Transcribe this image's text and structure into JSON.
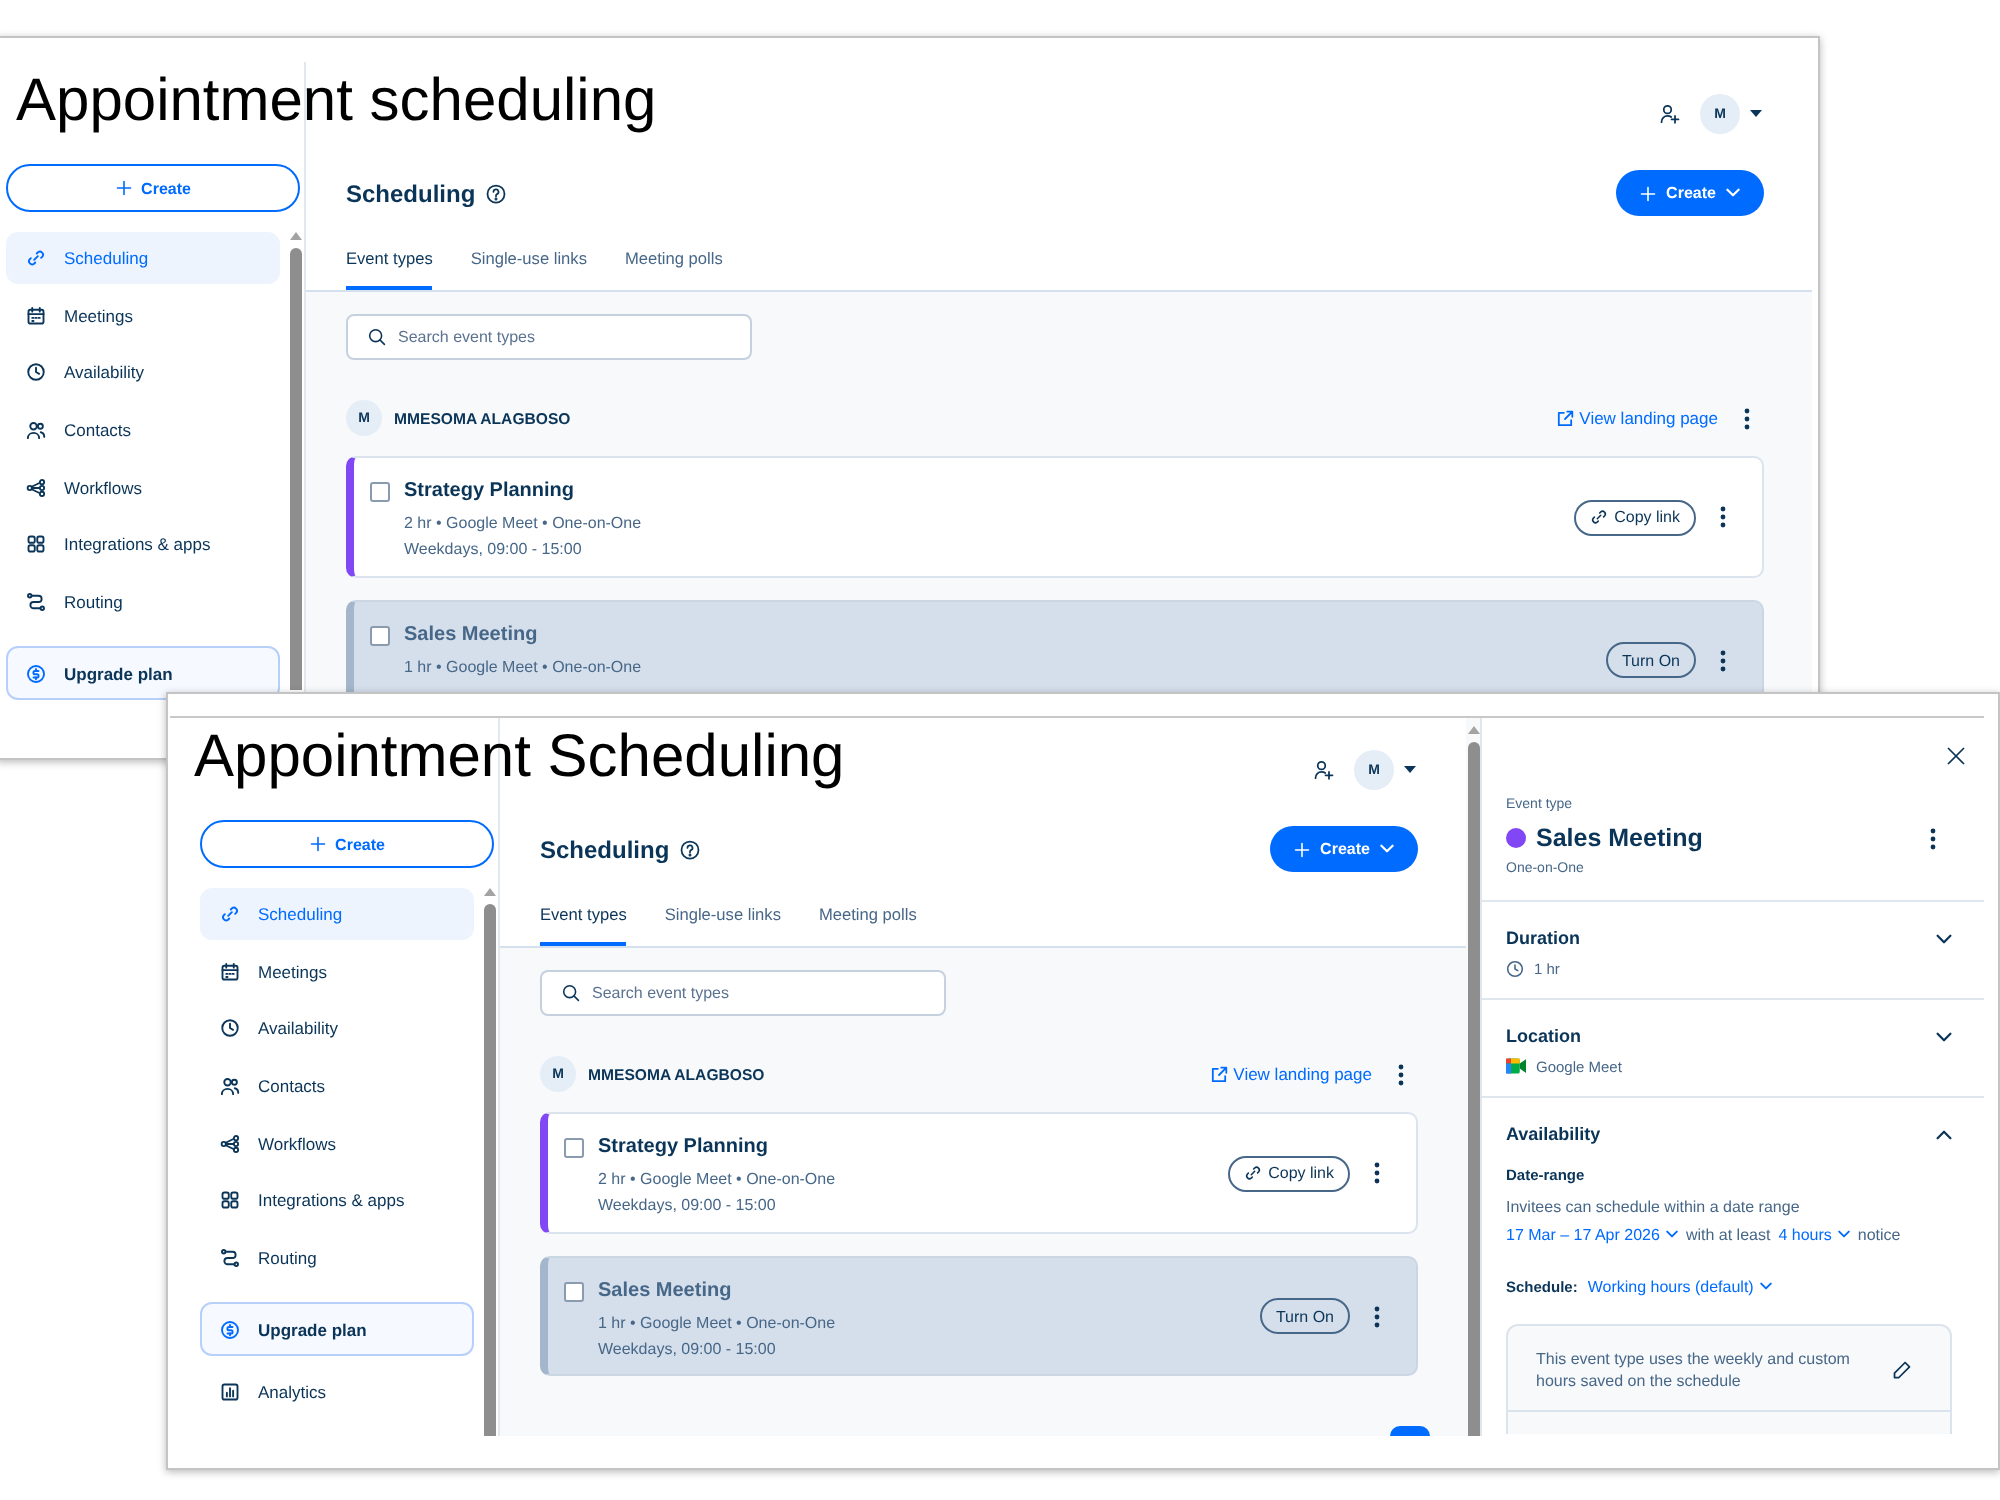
{
  "windows": [
    {
      "title": "Appointment scheduling",
      "sidebar": {
        "create_button": "Create",
        "items": [
          {
            "label": "Scheduling",
            "kind": "link",
            "selected": true
          },
          {
            "label": "Meetings",
            "kind": "link",
            "selected": false
          },
          {
            "label": "Availability",
            "kind": "link",
            "selected": false
          },
          {
            "label": "Contacts",
            "kind": "link",
            "selected": false
          },
          {
            "label": "Workflows",
            "kind": "link",
            "selected": false
          },
          {
            "label": "Integrations & apps",
            "kind": "link",
            "selected": false
          },
          {
            "label": "Routing",
            "kind": "link",
            "selected": false
          },
          {
            "label": "Upgrade plan",
            "kind": "upgrade",
            "selected": false
          }
        ]
      },
      "header": {
        "avatar": "M"
      },
      "page": {
        "title": "Scheduling",
        "create_button": "Create",
        "tabs": [
          {
            "label": "Event types",
            "selected": true
          },
          {
            "label": "Single-use links",
            "selected": false
          },
          {
            "label": "Meeting polls",
            "selected": false
          }
        ],
        "search": {
          "placeholder": "Search event types"
        },
        "owner": {
          "avatar": "M",
          "name": "MMESOMA ALAGBOSO",
          "link": "View landing page"
        },
        "event_types": [
          {
            "name": "Strategy Planning",
            "details": "2 hr • Google Meet • One-on-One",
            "schedule": "Weekdays, 09:00 - 15:00",
            "color": "#8247f5",
            "on": true,
            "checked": false,
            "action": {
              "kind": "copy",
              "label": "Copy link"
            }
          },
          {
            "name": "Sales Meeting",
            "details": "1 hr • Google Meet • One-on-One",
            "on": false,
            "checked": false,
            "action": {
              "kind": "toggle",
              "label": "Turn On"
            }
          }
        ]
      }
    },
    {
      "title": "Appointment Scheduling",
      "sidebar": {
        "create_button": "Create",
        "items": [
          {
            "label": "Scheduling",
            "kind": "link",
            "selected": true
          },
          {
            "label": "Meetings",
            "kind": "link",
            "selected": false
          },
          {
            "label": "Availability",
            "kind": "link",
            "selected": false
          },
          {
            "label": "Contacts",
            "kind": "link",
            "selected": false
          },
          {
            "label": "Workflows",
            "kind": "link",
            "selected": false
          },
          {
            "label": "Integrations & apps",
            "kind": "link",
            "selected": false
          },
          {
            "label": "Routing",
            "kind": "link",
            "selected": false
          },
          {
            "label": "Upgrade plan",
            "kind": "upgrade",
            "selected": false
          },
          {
            "label": "Analytics",
            "kind": "link",
            "selected": false
          }
        ]
      },
      "header": {
        "avatar": "M"
      },
      "page": {
        "title": "Scheduling",
        "create_button": "Create",
        "tabs": [
          {
            "label": "Event types",
            "selected": true
          },
          {
            "label": "Single-use links",
            "selected": false
          },
          {
            "label": "Meeting polls",
            "selected": false
          }
        ],
        "search": {
          "placeholder": "Search event types"
        },
        "owner": {
          "avatar": "M",
          "name": "MMESOMA ALAGBOSO",
          "link": "View landing page"
        },
        "event_types": [
          {
            "name": "Strategy Planning",
            "details": "2 hr • Google Meet • One-on-One",
            "schedule": "Weekdays, 09:00 - 15:00",
            "color": "#8247f5",
            "on": true,
            "checked": false,
            "action": {
              "kind": "copy",
              "label": "Copy link"
            }
          },
          {
            "name": "Sales Meeting",
            "details": "1 hr • Google Meet • One-on-One",
            "schedule": "Weekdays, 09:00 - 15:00",
            "on": false,
            "checked": false,
            "action": {
              "kind": "toggle",
              "label": "Turn On"
            }
          }
        ]
      },
      "floating_button": true,
      "panel": {
        "label": "Event type",
        "event": {
          "name": "Sales Meeting",
          "color": "#8247f5",
          "subtitle": "One-on-One"
        },
        "sections": [
          {
            "kind": "duration",
            "title": "Duration",
            "expanded": false,
            "value": "1 hr"
          },
          {
            "kind": "location",
            "title": "Location",
            "expanded": false,
            "value": "Google Meet"
          },
          {
            "kind": "availability",
            "title": "Availability",
            "expanded": true,
            "details": {
              "date_range_label": "Date-range",
              "description": "Invitees can schedule within a date range",
              "range": "17 Mar – 17 Apr 2026",
              "notice_prefix": "with at least",
              "notice": "4 hours",
              "notice_suffix": "notice",
              "schedule_label": "Schedule:",
              "schedule": "Working hours (default)",
              "note": "This event type uses the weekly and custom hours saved on the schedule"
            }
          }
        ]
      }
    }
  ]
}
